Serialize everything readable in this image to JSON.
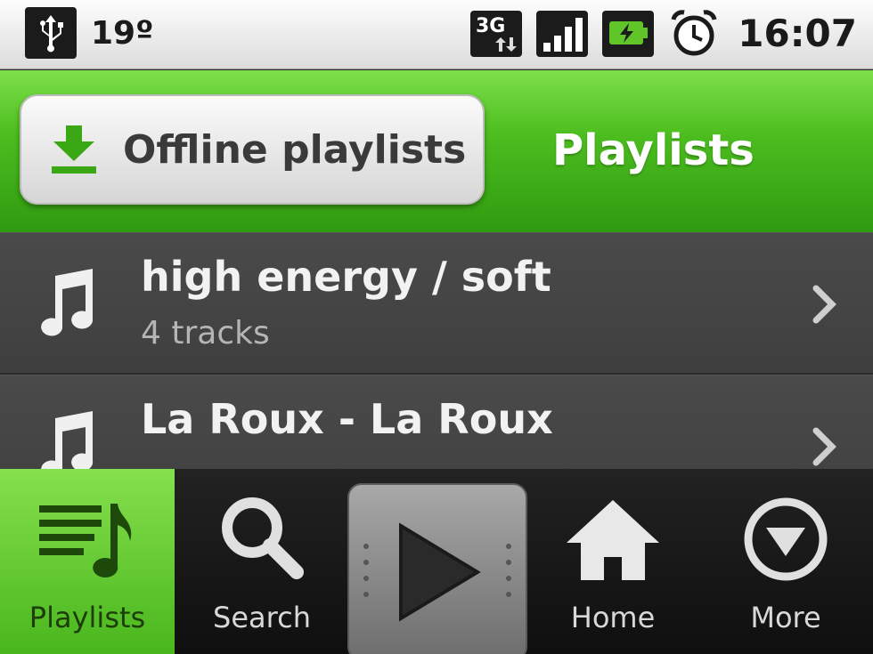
{
  "status_bar": {
    "temperature": "19º",
    "network_type": "3G",
    "time": "16:07",
    "icons": [
      "usb-icon",
      "network-3g-icon",
      "signal-icon",
      "battery-icon",
      "alarm-icon"
    ]
  },
  "header": {
    "offline_button_label": "Offline playlists",
    "title": "Playlists",
    "accent_color": "#4cbd1f"
  },
  "playlists": [
    {
      "title": "high energy / soft",
      "subtitle": "4 tracks"
    },
    {
      "title": "La Roux - La Roux",
      "subtitle": ""
    }
  ],
  "tabs": [
    {
      "label": "Playlists",
      "icon": "playlists-icon",
      "active": true
    },
    {
      "label": "Search",
      "icon": "search-icon",
      "active": false
    },
    {
      "label": "",
      "icon": "play-icon",
      "active": false
    },
    {
      "label": "Home",
      "icon": "home-icon",
      "active": false
    },
    {
      "label": "More",
      "icon": "more-icon",
      "active": false
    }
  ]
}
